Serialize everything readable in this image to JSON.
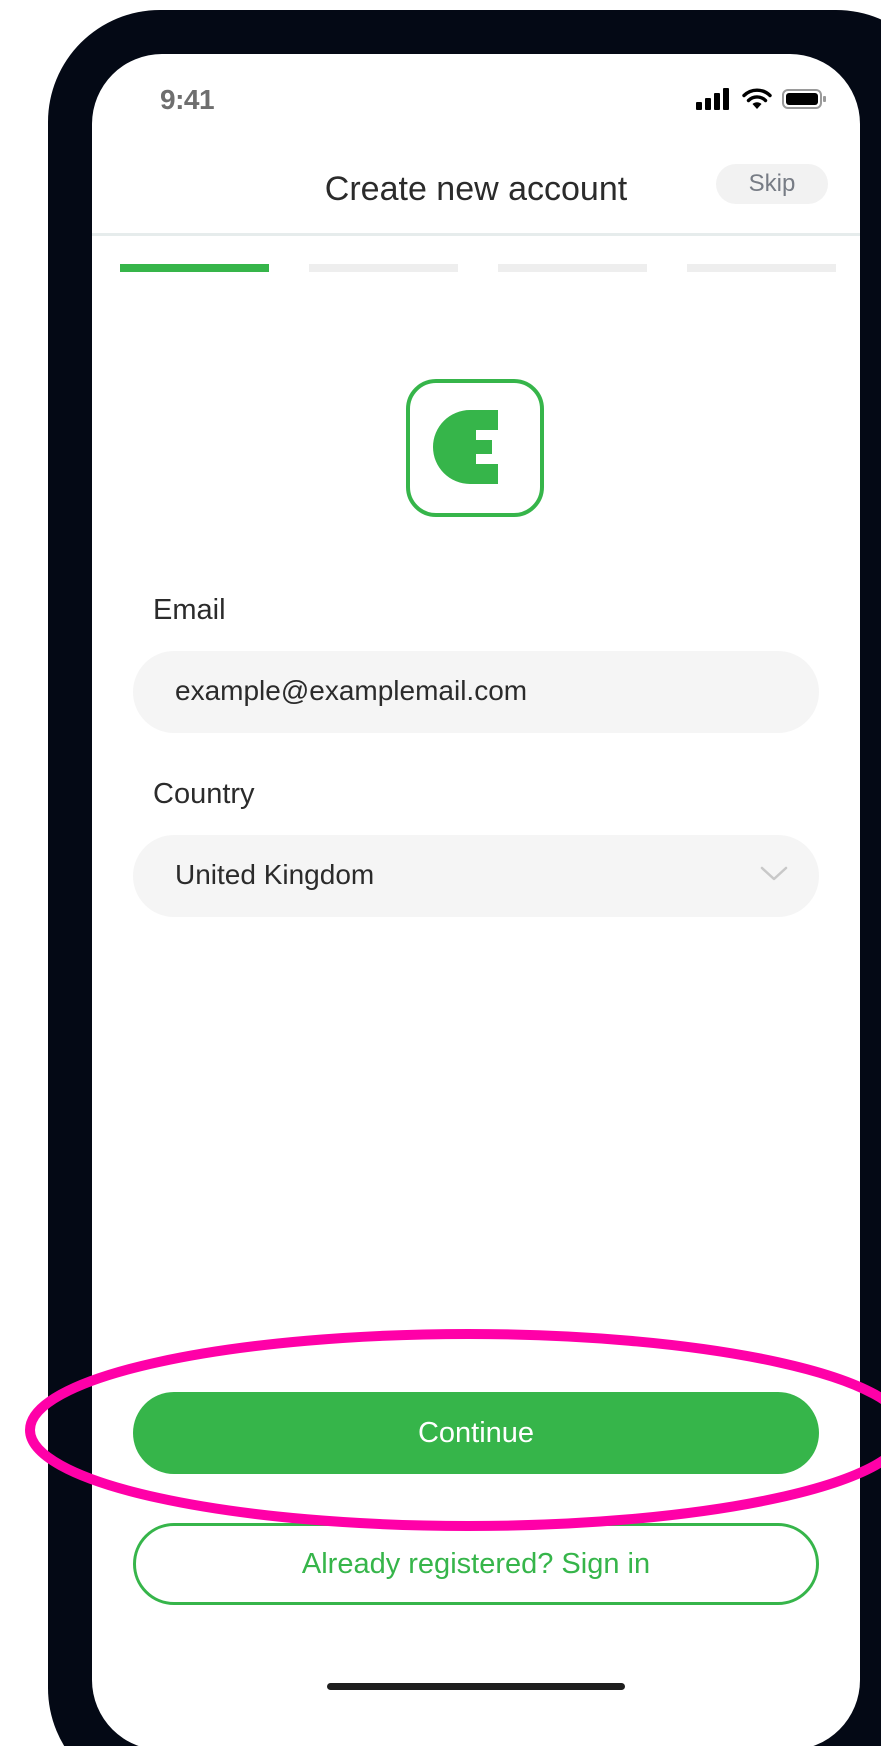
{
  "status_bar": {
    "time": "9:41"
  },
  "header": {
    "title": "Create new account",
    "skip_label": "Skip"
  },
  "progress": {
    "total_steps": 4,
    "current_step": 1
  },
  "form": {
    "email_label": "Email",
    "email_value": "example@examplemail.com",
    "country_label": "Country",
    "country_value": "United Kingdom"
  },
  "buttons": {
    "continue_label": "Continue",
    "signin_label": "Already registered? Sign in"
  },
  "icons": {
    "signal": "cellular-signal-icon",
    "wifi": "wifi-icon",
    "battery": "battery-icon",
    "chevron": "chevron-down-icon",
    "logo": "app-logo"
  },
  "colors": {
    "accent": "#36b54a",
    "phone_frame": "#040915",
    "annotation": "#ff00a8",
    "field_background": "#f5f5f5"
  }
}
